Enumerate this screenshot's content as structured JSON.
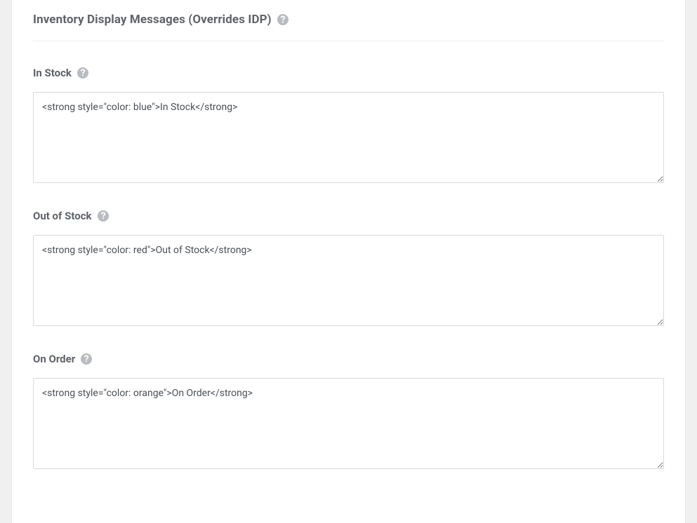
{
  "section": {
    "title": "Inventory Display Messages (Overrides IDP)"
  },
  "fields": {
    "in_stock": {
      "label": "In Stock",
      "value": "<strong style=\"color: blue\">In Stock</strong>"
    },
    "out_of_stock": {
      "label": "Out of Stock",
      "value": "<strong style=\"color: red\">Out of Stock</strong>"
    },
    "on_order": {
      "label": "On Order",
      "value": "<strong style=\"color: orange\">On Order</strong>"
    }
  }
}
